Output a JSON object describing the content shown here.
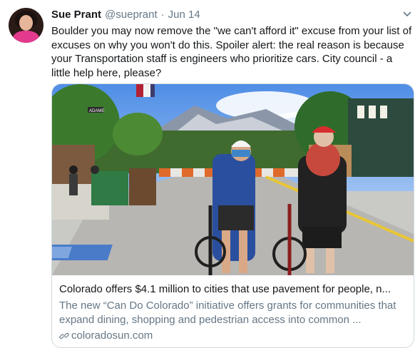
{
  "tweet": {
    "name": "Sue Prant",
    "handle": "@sueprant",
    "separator": "·",
    "date": "Jun 14",
    "text": "Boulder you may now remove the \"we can't afford it\" excuse from your list of excuses on why you won't do this. Spoiler alert: the real reason is because your Transportation staff is engineers who prioritize cars. City council - a little help here, please?"
  },
  "card": {
    "title": "Colorado offers $4.1 million to cities that use pavement for people, n...",
    "description": "The new “Can Do Colorado” initiative offers grants for communities that expand dining, shopping and pedestrian access into common ...",
    "domain": "coloradosun.com",
    "photo_street_sign": "ADAME"
  },
  "icons": {
    "caret": "chevron-down-icon",
    "link": "link-icon"
  },
  "colors": {
    "text": "#14171a",
    "secondary": "#657786",
    "border": "#cfd9de"
  }
}
